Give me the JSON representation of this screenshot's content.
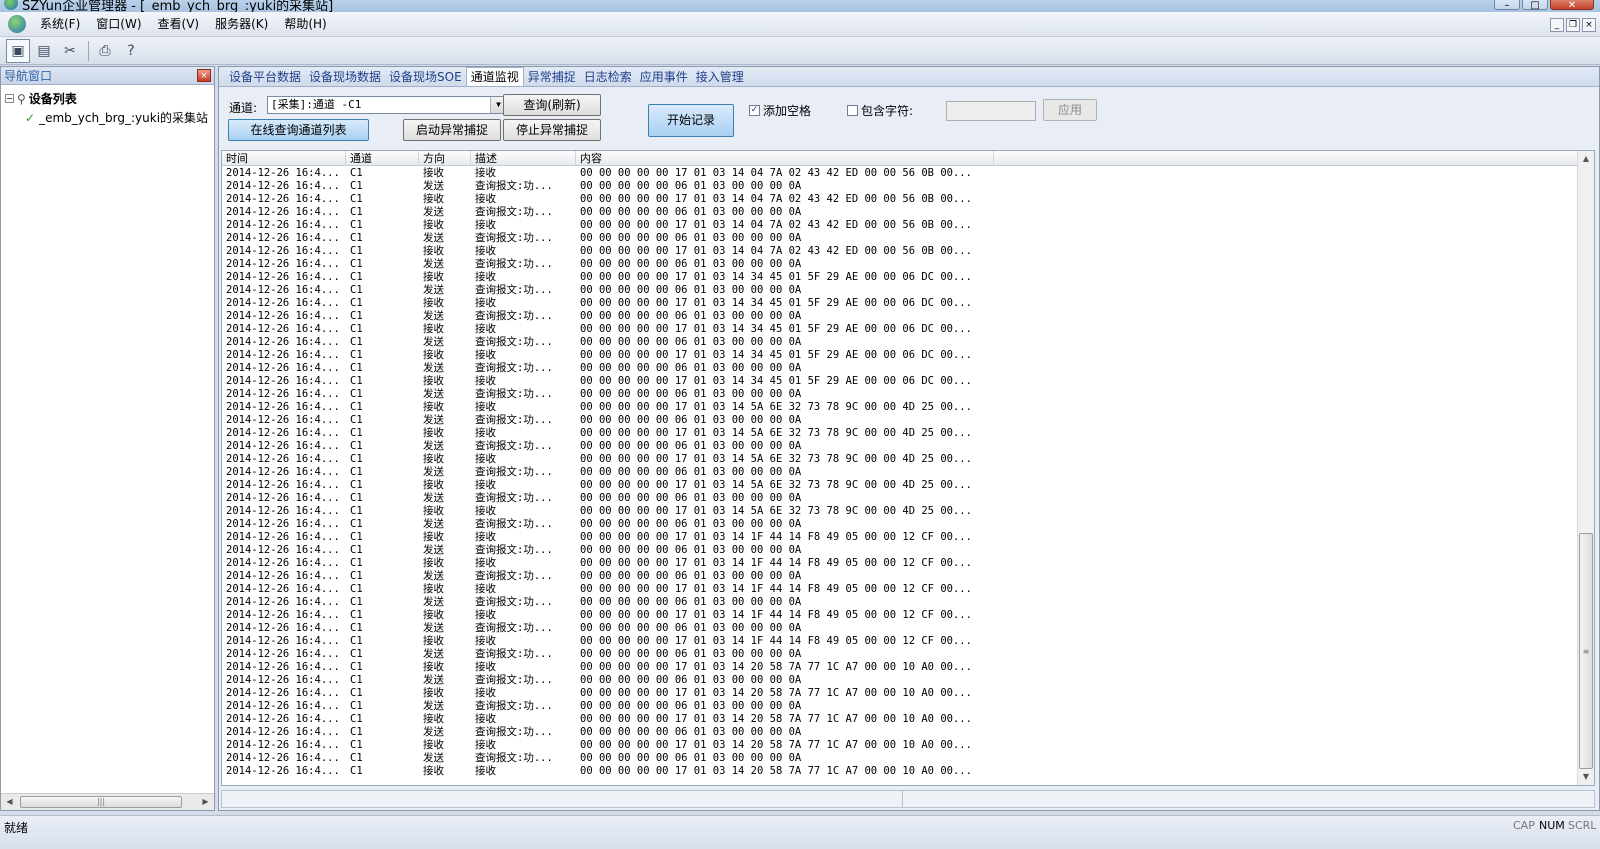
{
  "window": {
    "title": "SZYun企业管理器 - [_emb_ych_brg_:yuki的采集站]"
  },
  "menu": {
    "items": [
      "系统(F)",
      "窗口(W)",
      "查看(V)",
      "服务器(K)",
      "帮助(H)"
    ]
  },
  "nav": {
    "title": "导航窗口",
    "root_label": "设备列表",
    "child_label": "_emb_ych_brg_:yuki的采集站"
  },
  "tabs": [
    "设备平台数据",
    "设备现场数据",
    "设备现场SOE",
    "通道监视",
    "异常捕捉",
    "日志检索",
    "应用事件",
    "接入管理"
  ],
  "active_tab": "通道监视",
  "controls": {
    "channel_label": "通道:",
    "channel_value": "[采集]:通道 -C1",
    "query_button": "查询(刷新)",
    "online_button": "在线查询通道列表",
    "start_capture_button": "启动异常捕捉",
    "stop_capture_button": "停止异常捕捉",
    "start_record_button": "开始记录",
    "add_space_label": "添加空格",
    "add_space_checked": true,
    "include_label": "包含字符:",
    "include_checked": false,
    "include_value": "",
    "apply_button": "应用"
  },
  "grid": {
    "columns": [
      "时间",
      "通道",
      "方向",
      "描述",
      "内容"
    ],
    "rows": [
      [
        "2014-12-26 16:4...",
        "C1",
        "接收",
        "接收",
        "00 00 00 00 00 17 01 03 14 04 7A 02 43 42 ED 00 00 56 0B 00..."
      ],
      [
        "2014-12-26 16:4...",
        "C1",
        "发送",
        "查询报文:功...",
        "00 00 00 00 00 06 01 03 00 00 00 0A"
      ],
      [
        "2014-12-26 16:4...",
        "C1",
        "接收",
        "接收",
        "00 00 00 00 00 17 01 03 14 04 7A 02 43 42 ED 00 00 56 0B 00..."
      ],
      [
        "2014-12-26 16:4...",
        "C1",
        "发送",
        "查询报文:功...",
        "00 00 00 00 00 06 01 03 00 00 00 0A"
      ],
      [
        "2014-12-26 16:4...",
        "C1",
        "接收",
        "接收",
        "00 00 00 00 00 17 01 03 14 04 7A 02 43 42 ED 00 00 56 0B 00..."
      ],
      [
        "2014-12-26 16:4...",
        "C1",
        "发送",
        "查询报文:功...",
        "00 00 00 00 00 06 01 03 00 00 00 0A"
      ],
      [
        "2014-12-26 16:4...",
        "C1",
        "接收",
        "接收",
        "00 00 00 00 00 17 01 03 14 04 7A 02 43 42 ED 00 00 56 0B 00..."
      ],
      [
        "2014-12-26 16:4...",
        "C1",
        "发送",
        "查询报文:功...",
        "00 00 00 00 00 06 01 03 00 00 00 0A"
      ],
      [
        "2014-12-26 16:4...",
        "C1",
        "接收",
        "接收",
        "00 00 00 00 00 17 01 03 14 34 45 01 5F 29 AE 00 00 06 DC 00..."
      ],
      [
        "2014-12-26 16:4...",
        "C1",
        "发送",
        "查询报文:功...",
        "00 00 00 00 00 06 01 03 00 00 00 0A"
      ],
      [
        "2014-12-26 16:4...",
        "C1",
        "接收",
        "接收",
        "00 00 00 00 00 17 01 03 14 34 45 01 5F 29 AE 00 00 06 DC 00..."
      ],
      [
        "2014-12-26 16:4...",
        "C1",
        "发送",
        "查询报文:功...",
        "00 00 00 00 00 06 01 03 00 00 00 0A"
      ],
      [
        "2014-12-26 16:4...",
        "C1",
        "接收",
        "接收",
        "00 00 00 00 00 17 01 03 14 34 45 01 5F 29 AE 00 00 06 DC 00..."
      ],
      [
        "2014-12-26 16:4...",
        "C1",
        "发送",
        "查询报文:功...",
        "00 00 00 00 00 06 01 03 00 00 00 0A"
      ],
      [
        "2014-12-26 16:4...",
        "C1",
        "接收",
        "接收",
        "00 00 00 00 00 17 01 03 14 34 45 01 5F 29 AE 00 00 06 DC 00..."
      ],
      [
        "2014-12-26 16:4...",
        "C1",
        "发送",
        "查询报文:功...",
        "00 00 00 00 00 06 01 03 00 00 00 0A"
      ],
      [
        "2014-12-26 16:4...",
        "C1",
        "接收",
        "接收",
        "00 00 00 00 00 17 01 03 14 34 45 01 5F 29 AE 00 00 06 DC 00..."
      ],
      [
        "2014-12-26 16:4...",
        "C1",
        "发送",
        "查询报文:功...",
        "00 00 00 00 00 06 01 03 00 00 00 0A"
      ],
      [
        "2014-12-26 16:4...",
        "C1",
        "接收",
        "接收",
        "00 00 00 00 00 17 01 03 14 5A 6E 32 73 78 9C 00 00 4D 25 00..."
      ],
      [
        "2014-12-26 16:4...",
        "C1",
        "发送",
        "查询报文:功...",
        "00 00 00 00 00 06 01 03 00 00 00 0A"
      ],
      [
        "2014-12-26 16:4...",
        "C1",
        "接收",
        "接收",
        "00 00 00 00 00 17 01 03 14 5A 6E 32 73 78 9C 00 00 4D 25 00..."
      ],
      [
        "2014-12-26 16:4...",
        "C1",
        "发送",
        "查询报文:功...",
        "00 00 00 00 00 06 01 03 00 00 00 0A"
      ],
      [
        "2014-12-26 16:4...",
        "C1",
        "接收",
        "接收",
        "00 00 00 00 00 17 01 03 14 5A 6E 32 73 78 9C 00 00 4D 25 00..."
      ],
      [
        "2014-12-26 16:4...",
        "C1",
        "发送",
        "查询报文:功...",
        "00 00 00 00 00 06 01 03 00 00 00 0A"
      ],
      [
        "2014-12-26 16:4...",
        "C1",
        "接收",
        "接收",
        "00 00 00 00 00 17 01 03 14 5A 6E 32 73 78 9C 00 00 4D 25 00..."
      ],
      [
        "2014-12-26 16:4...",
        "C1",
        "发送",
        "查询报文:功...",
        "00 00 00 00 00 06 01 03 00 00 00 0A"
      ],
      [
        "2014-12-26 16:4...",
        "C1",
        "接收",
        "接收",
        "00 00 00 00 00 17 01 03 14 5A 6E 32 73 78 9C 00 00 4D 25 00..."
      ],
      [
        "2014-12-26 16:4...",
        "C1",
        "发送",
        "查询报文:功...",
        "00 00 00 00 00 06 01 03 00 00 00 0A"
      ],
      [
        "2014-12-26 16:4...",
        "C1",
        "接收",
        "接收",
        "00 00 00 00 00 17 01 03 14 1F 44 14 F8 49 05 00 00 12 CF 00..."
      ],
      [
        "2014-12-26 16:4...",
        "C1",
        "发送",
        "查询报文:功...",
        "00 00 00 00 00 06 01 03 00 00 00 0A"
      ],
      [
        "2014-12-26 16:4...",
        "C1",
        "接收",
        "接收",
        "00 00 00 00 00 17 01 03 14 1F 44 14 F8 49 05 00 00 12 CF 00..."
      ],
      [
        "2014-12-26 16:4...",
        "C1",
        "发送",
        "查询报文:功...",
        "00 00 00 00 00 06 01 03 00 00 00 0A"
      ],
      [
        "2014-12-26 16:4...",
        "C1",
        "接收",
        "接收",
        "00 00 00 00 00 17 01 03 14 1F 44 14 F8 49 05 00 00 12 CF 00..."
      ],
      [
        "2014-12-26 16:4...",
        "C1",
        "发送",
        "查询报文:功...",
        "00 00 00 00 00 06 01 03 00 00 00 0A"
      ],
      [
        "2014-12-26 16:4...",
        "C1",
        "接收",
        "接收",
        "00 00 00 00 00 17 01 03 14 1F 44 14 F8 49 05 00 00 12 CF 00..."
      ],
      [
        "2014-12-26 16:4...",
        "C1",
        "发送",
        "查询报文:功...",
        "00 00 00 00 00 06 01 03 00 00 00 0A"
      ],
      [
        "2014-12-26 16:4...",
        "C1",
        "接收",
        "接收",
        "00 00 00 00 00 17 01 03 14 1F 44 14 F8 49 05 00 00 12 CF 00..."
      ],
      [
        "2014-12-26 16:4...",
        "C1",
        "发送",
        "查询报文:功...",
        "00 00 00 00 00 06 01 03 00 00 00 0A"
      ],
      [
        "2014-12-26 16:4...",
        "C1",
        "接收",
        "接收",
        "00 00 00 00 00 17 01 03 14 20 58 7A 77 1C A7 00 00 10 A0 00..."
      ],
      [
        "2014-12-26 16:4...",
        "C1",
        "发送",
        "查询报文:功...",
        "00 00 00 00 00 06 01 03 00 00 00 0A"
      ],
      [
        "2014-12-26 16:4...",
        "C1",
        "接收",
        "接收",
        "00 00 00 00 00 17 01 03 14 20 58 7A 77 1C A7 00 00 10 A0 00..."
      ],
      [
        "2014-12-26 16:4...",
        "C1",
        "发送",
        "查询报文:功...",
        "00 00 00 00 00 06 01 03 00 00 00 0A"
      ],
      [
        "2014-12-26 16:4...",
        "C1",
        "接收",
        "接收",
        "00 00 00 00 00 17 01 03 14 20 58 7A 77 1C A7 00 00 10 A0 00..."
      ],
      [
        "2014-12-26 16:4...",
        "C1",
        "发送",
        "查询报文:功...",
        "00 00 00 00 00 06 01 03 00 00 00 0A"
      ],
      [
        "2014-12-26 16:4...",
        "C1",
        "接收",
        "接收",
        "00 00 00 00 00 17 01 03 14 20 58 7A 77 1C A7 00 00 10 A0 00..."
      ],
      [
        "2014-12-26 16:4...",
        "C1",
        "发送",
        "查询报文:功...",
        "00 00 00 00 00 06 01 03 00 00 00 0A"
      ],
      [
        "2014-12-26 16:4...",
        "C1",
        "接收",
        "接收",
        "00 00 00 00 00 17 01 03 14 20 58 7A 77 1C A7 00 00 10 A0 00..."
      ]
    ]
  },
  "status": {
    "text": "就绪",
    "indicators": [
      "CAP",
      "NUM",
      "SCRL"
    ],
    "active_indicator": "NUM"
  },
  "icons": {
    "toolbar": [
      "layout-icon",
      "window-icon",
      "tools-icon",
      "print-icon",
      "help-icon"
    ]
  }
}
